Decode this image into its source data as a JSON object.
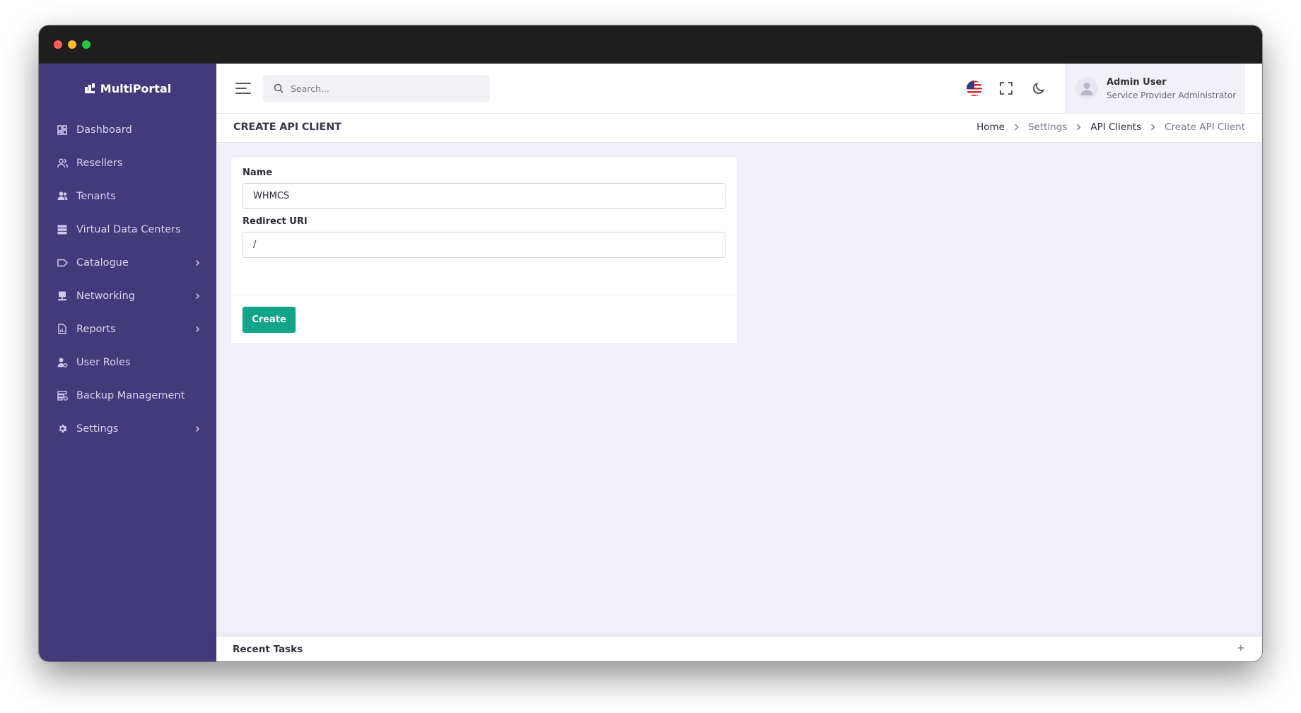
{
  "brand": {
    "name": "MultiPortal"
  },
  "sidebar": {
    "items": [
      {
        "label": "Dashboard",
        "icon": "dashboard-grid-icon",
        "has_submenu": false
      },
      {
        "label": "Resellers",
        "icon": "users-outline-icon",
        "has_submenu": false
      },
      {
        "label": "Tenants",
        "icon": "users-group-icon",
        "has_submenu": false
      },
      {
        "label": "Virtual Data Centers",
        "icon": "server-stack-icon",
        "has_submenu": false
      },
      {
        "label": "Catalogue",
        "icon": "tag-icon",
        "has_submenu": true
      },
      {
        "label": "Networking",
        "icon": "network-icon",
        "has_submenu": true
      },
      {
        "label": "Reports",
        "icon": "report-icon",
        "has_submenu": true
      },
      {
        "label": "User Roles",
        "icon": "user-roles-icon",
        "has_submenu": false
      },
      {
        "label": "Backup Management",
        "icon": "backup-icon",
        "has_submenu": false
      },
      {
        "label": "Settings",
        "icon": "gear-icon",
        "has_submenu": true
      }
    ]
  },
  "topbar": {
    "search_placeholder": "Search...",
    "language": "en-US",
    "user": {
      "name": "Admin User",
      "role": "Service Provider Administrator"
    }
  },
  "page": {
    "title": "CREATE API CLIENT",
    "breadcrumb": [
      "Home",
      "Settings",
      "API Clients",
      "Create API Client"
    ]
  },
  "form": {
    "name_label": "Name",
    "name_value": "WHMCS",
    "redirect_label": "Redirect URI",
    "redirect_value": "/",
    "submit_label": "Create"
  },
  "footer": {
    "recent_tasks_label": "Recent Tasks",
    "toggle_symbol": "+"
  },
  "colors": {
    "sidebar_bg": "#433a7c",
    "primary_button": "#11a58a",
    "content_bg": "#f1f0f9",
    "titlebar": "#1e1e1e"
  }
}
